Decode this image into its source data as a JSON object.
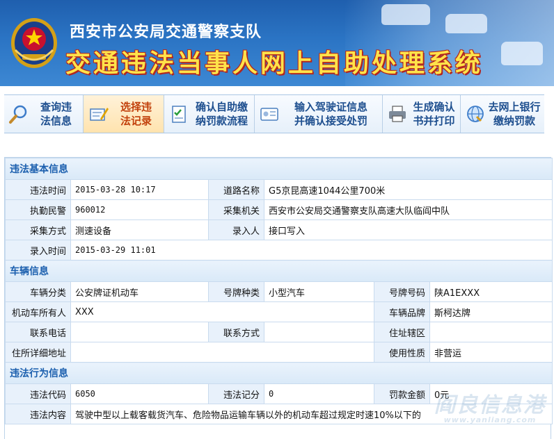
{
  "header": {
    "org_title": "西安市公安局交通警察支队",
    "system_title": "交通违法当事人网上自助处理系统"
  },
  "steps": [
    {
      "line1": "查询违",
      "line2": "法信息",
      "icon": "magnifier-icon",
      "active": false
    },
    {
      "line1": "选择违",
      "line2": "法记录",
      "icon": "select-record-icon",
      "active": true
    },
    {
      "line1": "确认自助缴",
      "line2": "纳罚款流程",
      "icon": "checklist-icon",
      "active": false
    },
    {
      "line1": "输入驾驶证信息",
      "line2": "并确认接受处罚",
      "icon": "license-icon",
      "active": false
    },
    {
      "line1": "生成确认",
      "line2": "书并打印",
      "icon": "printer-icon",
      "active": false
    },
    {
      "line1": "去网上银行",
      "line2": "缴纳罚款",
      "icon": "bank-globe-icon",
      "active": false
    }
  ],
  "sections": {
    "violation_basic": {
      "title": "违法基本信息",
      "time_label": "违法时间",
      "time_value": "2015-03-28 10:17",
      "road_label": "道路名称",
      "road_value": "G5京昆高速1044公里700米",
      "officer_label": "执勤民警",
      "officer_value": "960012",
      "agency_label": "采集机关",
      "agency_value": "西安市公安局交通警察支队高速大队临阎中队",
      "method_label": "采集方式",
      "method_value": "测速设备",
      "enterer_label": "录入人",
      "enterer_value": "接口写入",
      "entry_time_label": "录入时间",
      "entry_time_value": "2015-03-29 11:01"
    },
    "vehicle": {
      "title": "车辆信息",
      "category_label": "车辆分类",
      "category_value": "公安牌证机动车",
      "plate_type_label": "号牌种类",
      "plate_type_value": "小型汽车",
      "plate_no_label": "号牌号码",
      "plate_no_value": "陕A1EXXX",
      "owner_label": "机动车所有人",
      "owner_value": "XXX",
      "brand_label": "车辆品牌",
      "brand_value": "斯柯达牌",
      "phone_label": "联系电话",
      "phone_value": "",
      "contact_label": "联系方式",
      "contact_value": "",
      "district_label": "住址辖区",
      "district_value": "",
      "address_label": "住所详细地址",
      "address_value": "",
      "usage_label": "使用性质",
      "usage_value": "非营运"
    },
    "behavior": {
      "title": "违法行为信息",
      "code_label": "违法代码",
      "code_value": "6050",
      "points_label": "违法记分",
      "points_value": "0",
      "fine_label": "罚款金额",
      "fine_value": "0元",
      "content_label": "违法内容",
      "content_value": "驾驶中型以上载客载货汽车、危险物品运输车辆以外的机动车超过规定时速10%以下的"
    }
  },
  "watermark": {
    "text": "阎良信息港",
    "sub": "www.yanliang.com"
  },
  "colors": {
    "banner_blue": "#2b74c4",
    "title_yellow": "#ffe34a",
    "section_blue": "#1b5fae",
    "label_bg": "#e8f1fb"
  }
}
